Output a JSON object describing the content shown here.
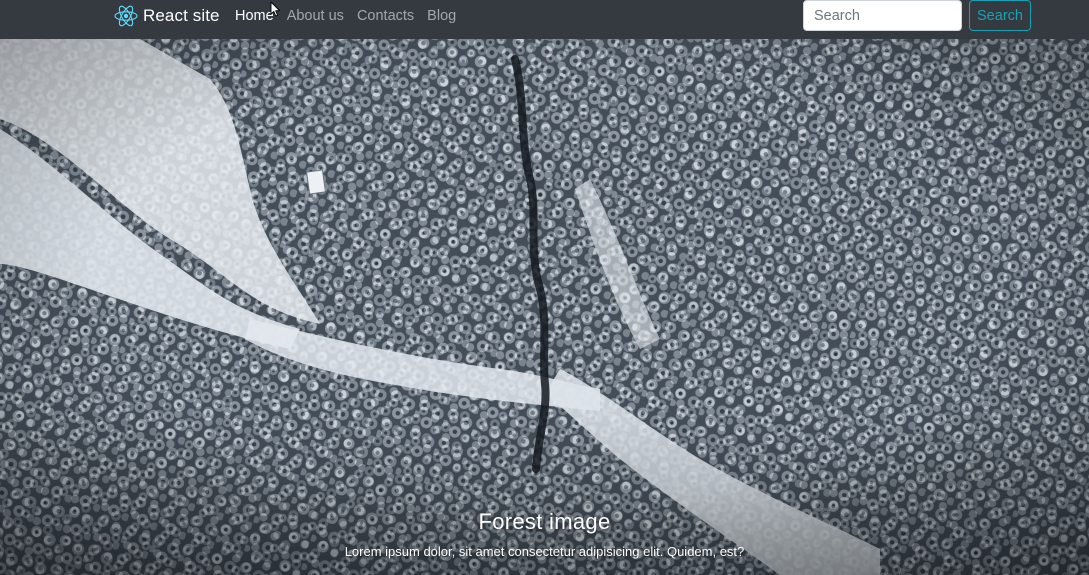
{
  "navbar": {
    "brand": {
      "label": "React site",
      "icon": "react-logo-icon"
    },
    "links": [
      {
        "label": "Home",
        "active": true
      },
      {
        "label": "About us",
        "active": false
      },
      {
        "label": "Contacts",
        "active": false
      },
      {
        "label": "Blog",
        "active": false
      }
    ],
    "search": {
      "placeholder": "Search",
      "value": "",
      "button_label": "Search"
    }
  },
  "hero": {
    "title": "Forest image",
    "text": "Lorem ipsum dolor, sit amet consectetur adipisicing elit. Quidem, est?",
    "image": "snowy-forest-aerial-photo"
  },
  "colors": {
    "navbar_bg": "#343a40",
    "brand_text": "#ffffff",
    "nav_link_active": "#ffffff",
    "nav_link_inactive": "#9a9da0",
    "react_logo": "#61dafb",
    "search_button_outline": "#17a2b8"
  }
}
